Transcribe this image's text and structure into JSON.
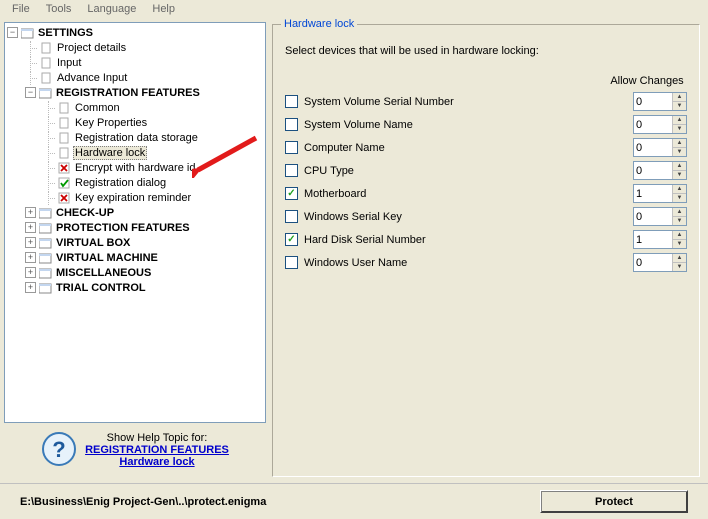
{
  "menu": {
    "items": [
      "File",
      "Tools",
      "Language",
      "Help"
    ]
  },
  "tree": {
    "root": {
      "label": "SETTINGS",
      "children": [
        {
          "label": "Project details",
          "icon": "page"
        },
        {
          "label": "Input",
          "icon": "page"
        },
        {
          "label": "Advance Input",
          "icon": "page"
        },
        {
          "label": "REGISTRATION FEATURES",
          "icon": "folder",
          "bold": true,
          "expanded": true,
          "children": [
            {
              "label": "Common",
              "icon": "page"
            },
            {
              "label": "Key Properties",
              "icon": "page"
            },
            {
              "label": "Registration data storage",
              "icon": "page"
            },
            {
              "label": "Hardware lock",
              "icon": "page",
              "selected": true
            },
            {
              "label": "Encrypt with hardware id",
              "icon": "xred"
            },
            {
              "label": "Registration dialog",
              "icon": "check"
            },
            {
              "label": "Key expiration reminder",
              "icon": "xred"
            }
          ]
        },
        {
          "label": "CHECK-UP",
          "icon": "folder",
          "bold": true,
          "expanded": false
        },
        {
          "label": "PROTECTION FEATURES",
          "icon": "folder",
          "bold": true,
          "expanded": false
        },
        {
          "label": "VIRTUAL BOX",
          "icon": "folder",
          "bold": true,
          "expanded": false
        },
        {
          "label": "VIRTUAL MACHINE",
          "icon": "folder",
          "bold": true,
          "expanded": false
        },
        {
          "label": "MISCELLANEOUS",
          "icon": "folder",
          "bold": true,
          "expanded": false
        },
        {
          "label": "TRIAL CONTROL",
          "icon": "folder",
          "bold": true,
          "expanded": false
        }
      ]
    }
  },
  "help": {
    "title": "Show Help Topic for:",
    "link1": "REGISTRATION FEATURES",
    "link2": "Hardware lock"
  },
  "group": {
    "legend": "Hardware lock",
    "desc": "Select devices that will be used in hardware locking:",
    "allow_header": "Allow Changes",
    "rows": [
      {
        "label": "System Volume Serial Number",
        "checked": false,
        "value": "0"
      },
      {
        "label": "System Volume Name",
        "checked": false,
        "value": "0"
      },
      {
        "label": "Computer Name",
        "checked": false,
        "value": "0"
      },
      {
        "label": "CPU Type",
        "checked": false,
        "value": "0"
      },
      {
        "label": "Motherboard",
        "checked": true,
        "value": "1"
      },
      {
        "label": "Windows Serial Key",
        "checked": false,
        "value": "0"
      },
      {
        "label": "Hard Disk Serial Number",
        "checked": true,
        "value": "1"
      },
      {
        "label": "Windows User Name",
        "checked": false,
        "value": "0"
      }
    ]
  },
  "bottom": {
    "path": "E:\\Business\\Enig Project-Gen\\..\\protect.enigma",
    "protect": "Protect"
  }
}
